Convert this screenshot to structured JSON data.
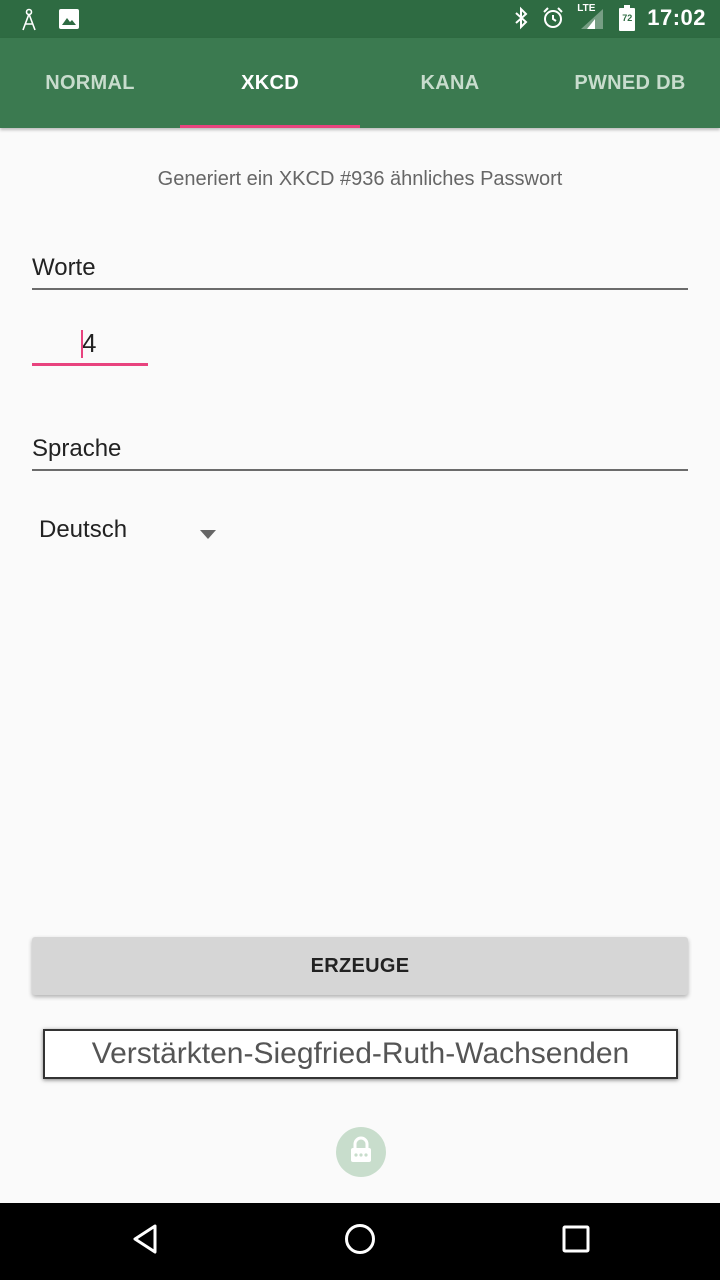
{
  "status_bar": {
    "time": "17:02",
    "battery": "72",
    "network": "LTE",
    "icons": [
      "signal-tower-icon",
      "image-icon",
      "bluetooth-icon",
      "alarm-icon",
      "cell-signal-icon",
      "battery-icon"
    ]
  },
  "tabs": [
    {
      "label": "NORMAL",
      "active": false
    },
    {
      "label": "XKCD",
      "active": true
    },
    {
      "label": "KANA",
      "active": false
    },
    {
      "label": "PWNED DB",
      "active": false
    }
  ],
  "main": {
    "subtitle": "Generiert ein XKCD #936 ähnliches Passwort",
    "words_label": "Worte",
    "words_value": "4",
    "language_label": "Sprache",
    "language_selected": "Deutsch",
    "generate_button": "ERZEUGE",
    "password": "Verstärkten-Siegfried-Ruth-Wachsenden"
  },
  "colors": {
    "status_bar": "#2e6b42",
    "app_bar": "#3b7a50",
    "accent": "#e8437e",
    "background": "#fafafa"
  },
  "nav_bar": {
    "icons": [
      "back-icon",
      "home-icon",
      "recents-icon"
    ]
  }
}
